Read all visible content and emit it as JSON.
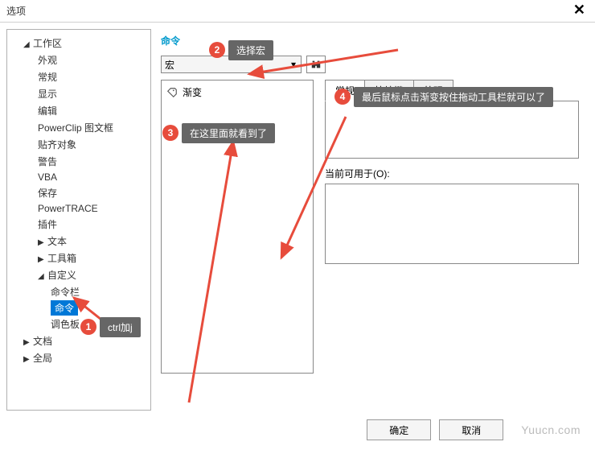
{
  "window": {
    "title": "选项"
  },
  "tree": {
    "items": [
      {
        "label": "工作区",
        "level": 0,
        "arrow": "▶"
      },
      {
        "label": "外观",
        "level": 1
      },
      {
        "label": "常规",
        "level": 1
      },
      {
        "label": "显示",
        "level": 1
      },
      {
        "label": "编辑",
        "level": 1
      },
      {
        "label": "PowerClip 图文框",
        "level": 1
      },
      {
        "label": "贴齐对象",
        "level": 1
      },
      {
        "label": "警告",
        "level": 1
      },
      {
        "label": "VBA",
        "level": 1
      },
      {
        "label": "保存",
        "level": 1
      },
      {
        "label": "PowerTRACE",
        "level": 1
      },
      {
        "label": "插件",
        "level": 1
      },
      {
        "label": "文本",
        "level": 1,
        "arrow": "▶"
      },
      {
        "label": "工具箱",
        "level": 1,
        "arrow": "▶"
      },
      {
        "label": "自定义",
        "level": 1,
        "arrow": "◢"
      },
      {
        "label": "命令栏",
        "level": 2
      },
      {
        "label": "命令",
        "level": 2,
        "sel": true
      },
      {
        "label": "调色板",
        "level": 2
      },
      {
        "label": "文档",
        "level": 0,
        "arrow": "▶"
      },
      {
        "label": "全局",
        "level": 0,
        "arrow": "▶"
      }
    ]
  },
  "panel": {
    "title": "命令",
    "dropdown": "宏",
    "list_item": "渐变",
    "tabs": [
      "常规",
      "快捷键",
      "外观"
    ],
    "available_label": "当前可用于(O):"
  },
  "buttons": {
    "ok": "确定",
    "cancel": "取消"
  },
  "watermark": "Yuucn.com",
  "annotations": {
    "b1": "1",
    "t1": "ctrl加j",
    "b2": "2",
    "t2": "选择宏",
    "b3": "3",
    "t3": "在这里面就看到了",
    "b4": "4",
    "t4": "最后鼠标点击渐变按住拖动工具栏就可以了"
  }
}
